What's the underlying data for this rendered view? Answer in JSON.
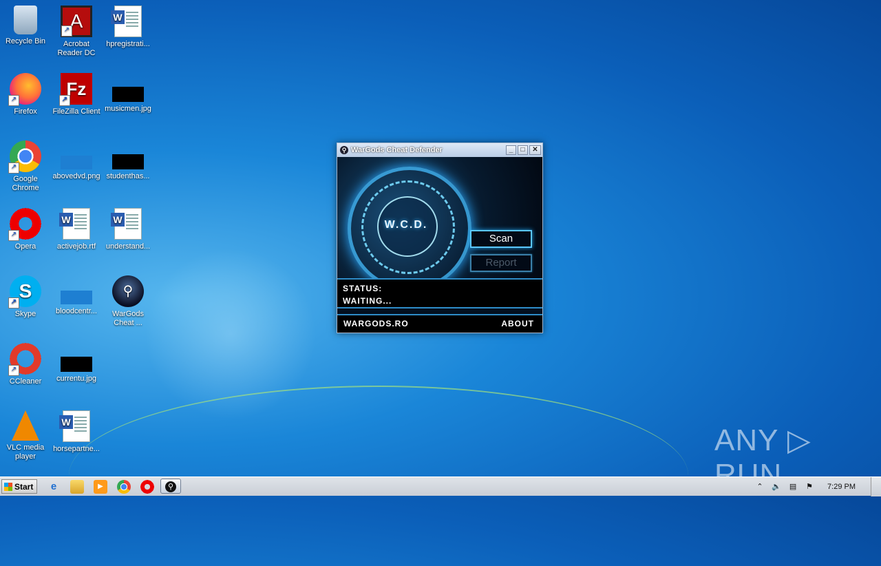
{
  "desktop": {
    "icons": [
      {
        "label": "Recycle Bin",
        "icon": "recycle-bin-icon"
      },
      {
        "label": "Acrobat\nReader DC",
        "icon": "acrobat-icon"
      },
      {
        "label": "hpregistrati...",
        "icon": "word-doc-icon"
      },
      {
        "label": "Firefox",
        "icon": "firefox-icon"
      },
      {
        "label": "FileZilla Client",
        "icon": "filezilla-icon"
      },
      {
        "label": "musicmen.jpg",
        "icon": "image-thumbnail-icon"
      },
      {
        "label": "Google\nChrome",
        "icon": "chrome-icon"
      },
      {
        "label": "abovedvd.png",
        "icon": "image-thumbnail-icon"
      },
      {
        "label": "studenthas...",
        "icon": "image-thumbnail-icon"
      },
      {
        "label": "Opera",
        "icon": "opera-icon"
      },
      {
        "label": "activejob.rtf",
        "icon": "word-doc-icon"
      },
      {
        "label": "understand...",
        "icon": "word-doc-icon"
      },
      {
        "label": "Skype",
        "icon": "skype-icon"
      },
      {
        "label": "bloodcentr...",
        "icon": "image-thumbnail-icon"
      },
      {
        "label": "WarGods\nCheat ...",
        "icon": "wargods-icon"
      },
      {
        "label": "CCleaner",
        "icon": "ccleaner-icon"
      },
      {
        "label": "currentu.jpg",
        "icon": "image-thumbnail-icon"
      },
      {
        "label": "VLC media\nplayer",
        "icon": "vlc-icon"
      },
      {
        "label": "horsepartne...",
        "icon": "word-doc-icon"
      }
    ]
  },
  "window": {
    "title": "WarGods Cheat Defender",
    "logo_text": "W.C.D.",
    "scan_button": "Scan",
    "report_button": "Report",
    "status_label": "STATUS:",
    "status_value": "WAITING...",
    "progress_fraction": 0.0,
    "footer_left": "WARGODS.RO",
    "footer_right": "ABOUT",
    "controls": {
      "minimize": "_",
      "maximize": "□",
      "close": "✕"
    }
  },
  "watermark": "ANY ▷ RUN",
  "taskbar": {
    "start_label": "Start",
    "clock": "7:29 PM"
  },
  "colors": {
    "accent": "#5cc8ff",
    "window_bg": "#000000",
    "desktop": "#1a86d8"
  }
}
